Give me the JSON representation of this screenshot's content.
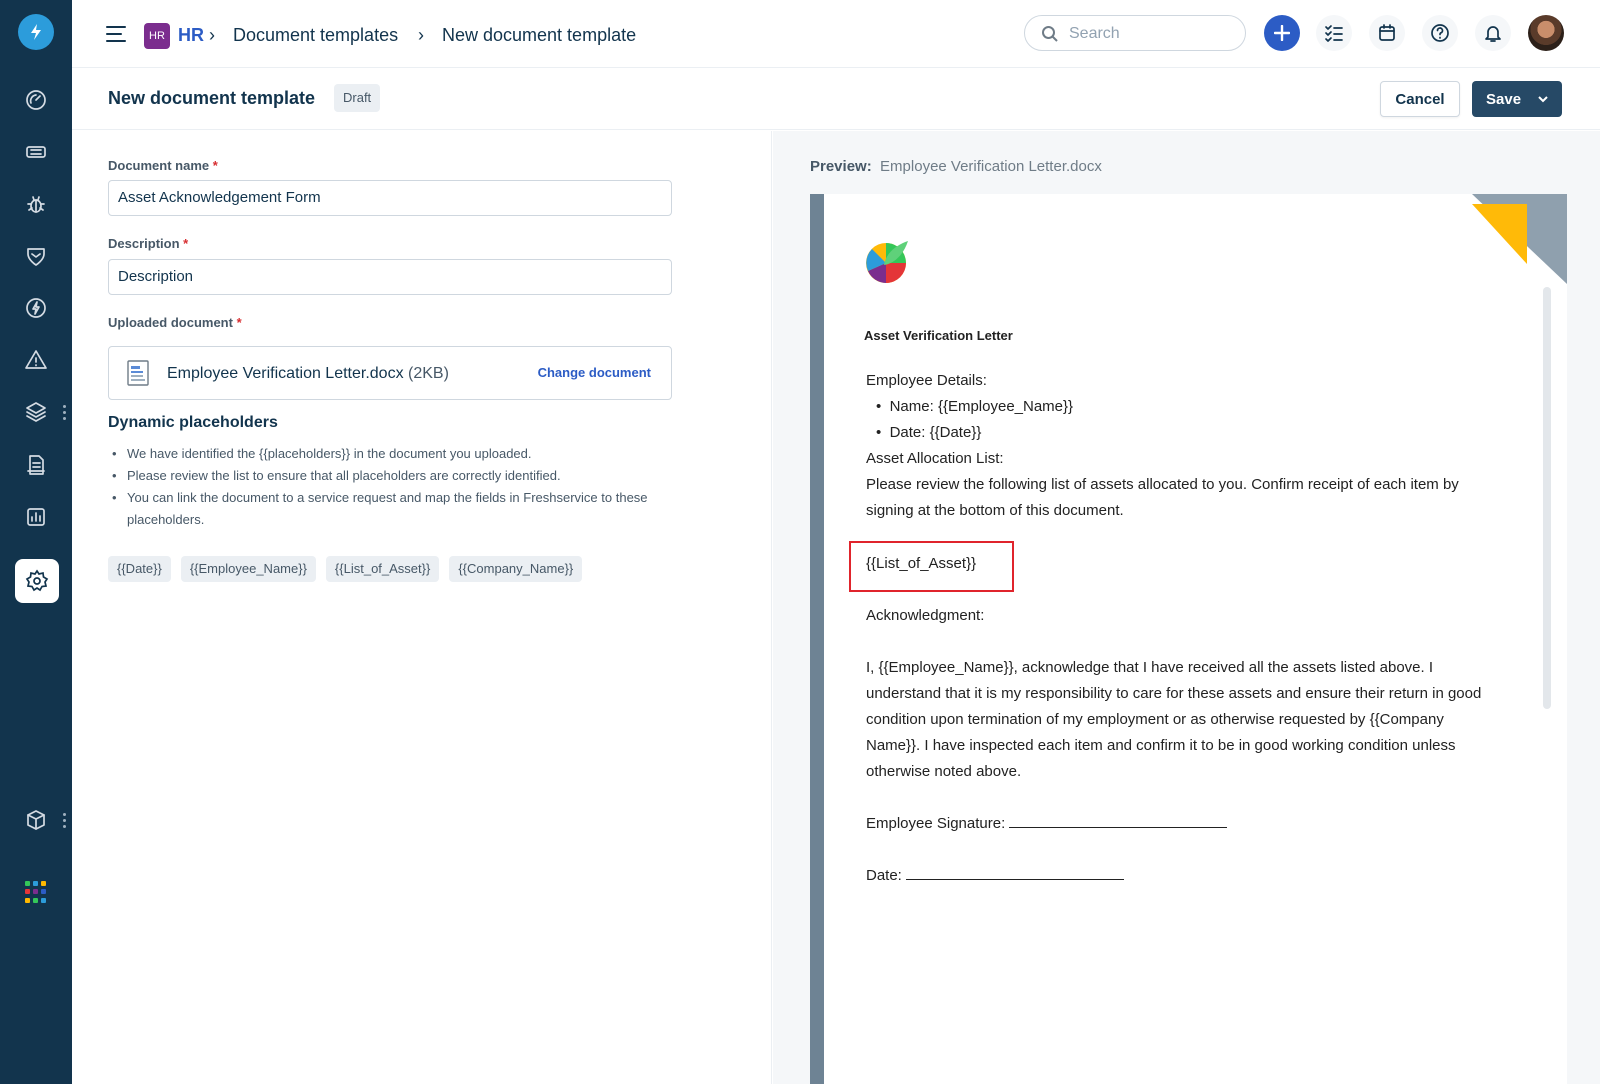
{
  "colors": {
    "rail": "#12344d",
    "accent": "#2c5cc5",
    "save": "#264966",
    "required": "#d72d30",
    "highlight": "#e0242c"
  },
  "header": {
    "app_badge": "HR",
    "breadcrumb": [
      "HR",
      "Document templates",
      "New document template"
    ],
    "search_placeholder": "Search"
  },
  "page": {
    "title": "New document template",
    "status": "Draft",
    "cancel_label": "Cancel",
    "save_label": "Save"
  },
  "form": {
    "name_label": "Document name",
    "name_value": "Asset Acknowledgement Form",
    "description_label": "Description",
    "description_value": "Description",
    "upload_label": "Uploaded document",
    "upload_filename": "Employee Verification Letter.docx",
    "upload_size": "(2KB)",
    "change_label": "Change document",
    "placeholders_title": "Dynamic placeholders",
    "bullets": [
      "We have identified the {{placeholders}} in the document you uploaded.",
      "Please review the list to ensure that all placeholders are correctly identified.",
      "You can link the document to a service request and map the fields in Freshservice to these placeholders."
    ],
    "chips": [
      "{{Date}}",
      "{{Employee_Name}}",
      "{{List_of_Asset}}",
      "{{Company_Name}}"
    ]
  },
  "preview": {
    "label": "Preview:",
    "filename": "Employee Verification Letter.docx",
    "doc_title": "Asset Verification Letter",
    "details_heading": "Employee Details:",
    "name_line": "Name: {{Employee_Name}}",
    "date_line": "Date: {{Date}}",
    "allocation_heading": "Asset Allocation List:",
    "allocation_para": [
      "Please review the following list of assets allocated to you. Confirm receipt of each item by",
      "signing at the bottom of this document."
    ],
    "list_placeholder": "{{List_of_Asset}}",
    "ack_heading": "Acknowledgment:",
    "ack_para": [
      "I, {{Employee_Name}}, acknowledge that I have received all the assets listed above. I",
      "understand that it is my responsibility to care for these assets and ensure their return in good",
      "condition upon termination of my employment or as otherwise requested by {{Company",
      "Name}}. I have inspected each item and confirm it to be in good working condition unless",
      "otherwise noted above."
    ],
    "signature_label": "Employee Signature:",
    "date_label": "Date:"
  },
  "icons": {
    "rail": [
      "freshservice-logo",
      "dashboard-icon",
      "ticket-icon",
      "bug-icon",
      "shield-icon",
      "lightning-icon",
      "alert-icon",
      "layers-icon",
      "document-icon",
      "reports-icon",
      "settings-icon",
      "box-icon",
      "apps-grid-icon"
    ],
    "top": [
      "menu-icon",
      "search-icon",
      "plus-icon",
      "tasks-icon",
      "calendar-icon",
      "help-icon",
      "bell-icon"
    ]
  }
}
